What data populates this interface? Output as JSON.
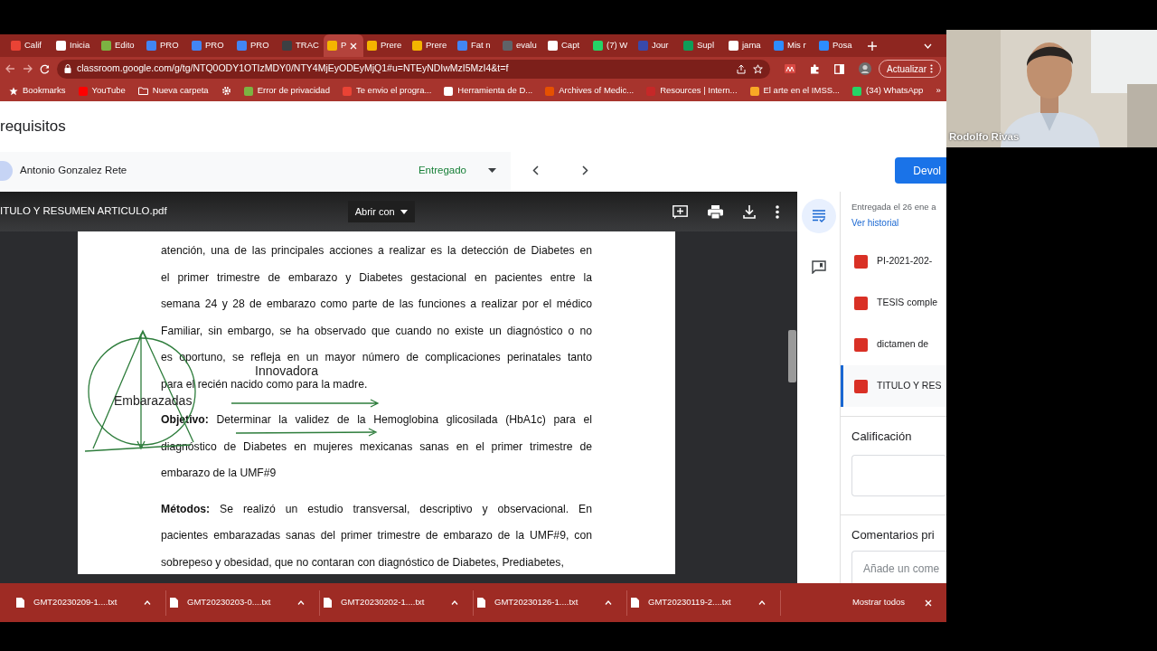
{
  "browser": {
    "tabs": [
      {
        "title": "Calif",
        "color": "#ea4335",
        "selected": false
      },
      {
        "title": "Inicia",
        "color": "#ffffff",
        "selected": false
      },
      {
        "title": "Edito",
        "color": "#7cb342",
        "selected": false
      },
      {
        "title": "PRO",
        "color": "#4285f4",
        "selected": false
      },
      {
        "title": "PRO",
        "color": "#4285f4",
        "selected": false
      },
      {
        "title": "PRO",
        "color": "#4285f4",
        "selected": false
      },
      {
        "title": "TRAC",
        "color": "#3c4043",
        "selected": false
      },
      {
        "title": "P",
        "color": "#f4b400",
        "selected": true
      },
      {
        "title": "Prere",
        "color": "#f4b400",
        "selected": false
      },
      {
        "title": "Prere",
        "color": "#f4b400",
        "selected": false
      },
      {
        "title": "Fat n",
        "color": "#4285f4",
        "selected": false
      },
      {
        "title": "evalu",
        "color": "#5f6368",
        "selected": false
      },
      {
        "title": "Capt",
        "color": "#ffffff",
        "selected": false
      },
      {
        "title": "(7) W",
        "color": "#25d366",
        "selected": false
      },
      {
        "title": "Jour",
        "color": "#3949ab",
        "selected": false
      },
      {
        "title": "Supl",
        "color": "#0f9d58",
        "selected": false
      },
      {
        "title": "jama",
        "color": "#ffffff",
        "selected": false
      },
      {
        "title": "Mis r",
        "color": "#2d8cff",
        "selected": false
      },
      {
        "title": "Posa",
        "color": "#2d8cff",
        "selected": false
      }
    ],
    "address_bar": {
      "url": "classroom.google.com/g/tg/NTQ0ODY1OTIzMDY0/NTY4MjEyODEyMjQ1#u=NTEyNDIwMzI5MzI4&t=f"
    },
    "update_button": "Actualizar",
    "bookmarks": [
      {
        "kind": "star",
        "label": "Bookmarks"
      },
      {
        "kind": "link",
        "label": "YouTube",
        "color": "#ff0000"
      },
      {
        "kind": "folder",
        "label": "Nueva carpeta"
      },
      {
        "kind": "gear"
      },
      {
        "kind": "link",
        "label": "Error de privacidad",
        "color": "#7cb342"
      },
      {
        "kind": "link",
        "label": "Te envio el progra...",
        "color": "#ea4335"
      },
      {
        "kind": "link",
        "label": "Herramienta de D...",
        "color": "#ffffff"
      },
      {
        "kind": "link",
        "label": "Archives of Medic...",
        "color": "#e65100"
      },
      {
        "kind": "link",
        "label": "Resources | Intern...",
        "color": "#c62828"
      },
      {
        "kind": "link",
        "label": "El arte en el IMSS...",
        "color": "#f9a825"
      },
      {
        "kind": "link",
        "label": "(34) WhatsApp",
        "color": "#25d366"
      }
    ],
    "bookmarks_overflow": "»"
  },
  "page": {
    "title": "requisitos",
    "student": {
      "name": "Antonio Gonzalez Rete",
      "status": "Entregado"
    },
    "return_button": "Devol",
    "viewer": {
      "file_name": "ITULO Y RESUMEN ARTICULO.pdf",
      "open_with_button": "Abrir con",
      "paragraphs": [
        {
          "lines": [
            "atención, una de las principales acciones a realizar es la detección de Diabetes en",
            "el primer trimestre de embarazo y Diabetes gestacional en pacientes entre la",
            "semana 24 y 28 de embarazo como parte de las funciones a realizar por el médico",
            "Familiar, sin embargo, se ha observado que cuando no existe un diagnóstico o no",
            "es oportuno, se refleja en un mayor número de complicaciones perinatales tanto",
            "para el recién nacido como para la madre."
          ]
        },
        {
          "lines": [
            "**Objetivo:** Determinar la validez de la Hemoglobina glicosilada (HbA1c) para el",
            "diagnóstico de Diabetes en mujeres mexicanas sanas en el primer trimestre de",
            "embarazo de la UMF#9"
          ]
        },
        {
          "lines": [
            "**Métodos:** Se realizó un estudio transversal, descriptivo y observacional. En",
            "pacientes embarazadas sanas del primer trimestre de embarazo de la UMF#9, con",
            "sobrepeso y obesidad, que no contaran con diagnóstico de Diabetes, Prediabetes,"
          ]
        }
      ],
      "annotations": [
        "Embarazadas",
        "Innovadora"
      ]
    },
    "side_panel": {
      "submitted": "Entregada el 26 ene a",
      "history_link": "Ver historial",
      "files": [
        {
          "name": "PI-2021-202-",
          "selected": false
        },
        {
          "name": "TESIS comple",
          "selected": false
        },
        {
          "name": "dictamen de",
          "selected": false
        },
        {
          "name": "TITULO Y RES",
          "selected": true
        }
      ],
      "grade_heading": "Calificación",
      "comments_heading": "Comentarios pri",
      "comment_placeholder": "Añade un come"
    }
  },
  "downloads": {
    "items": [
      "GMT20230209-1....txt",
      "GMT20230203-0....txt",
      "GMT20230202-1....txt",
      "GMT20230126-1....txt",
      "GMT20230119-2....txt"
    ],
    "show_all": "Mostrar todos"
  },
  "video": {
    "participant_name": "Rodolfo Rivas"
  }
}
